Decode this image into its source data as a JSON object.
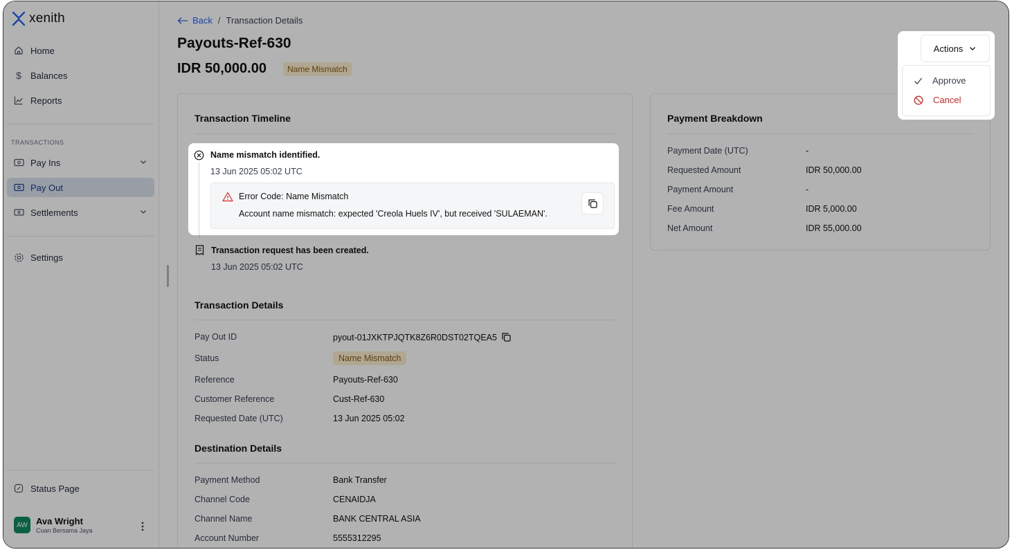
{
  "app": {
    "name": "xenith"
  },
  "sidebar": {
    "home": "Home",
    "balances": "Balances",
    "reports": "Reports",
    "section_label": "TRANSACTIONS",
    "pay_ins": "Pay Ins",
    "pay_out": "Pay Out",
    "settlements": "Settlements",
    "settings": "Settings",
    "status_page": "Status Page",
    "user": {
      "initials": "AW",
      "name": "Ava Wright",
      "org": "Cuan Bersama Jaya"
    }
  },
  "breadcrumb": {
    "back": "Back",
    "separator": "/",
    "current": "Transaction Details"
  },
  "header": {
    "title": "Payouts-Ref-630",
    "amount": "IDR 50,000.00",
    "status_badge": "Name Mismatch"
  },
  "actions": {
    "label": "Actions",
    "items": {
      "approve": "Approve",
      "cancel": "Cancel"
    }
  },
  "timeline": {
    "title": "Transaction Timeline",
    "items": [
      {
        "heading": "Name mismatch identified.",
        "time": "13 Jun 2025 05:02 UTC",
        "error_code": "Error Code: Name Mismatch",
        "error_message": "Account name mismatch: expected 'Creola Huels IV', but received 'SULAEMAN'."
      },
      {
        "heading": "Transaction request has been created.",
        "time": "13 Jun 2025 05:02 UTC"
      }
    ]
  },
  "details": {
    "title": "Transaction Details",
    "rows": [
      {
        "label": "Pay Out ID",
        "value": "pyout-01JXKTPJQTK8Z6R0DST02TQEA5"
      },
      {
        "label": "Status",
        "value": "Name Mismatch"
      },
      {
        "label": "Reference",
        "value": "Payouts-Ref-630"
      },
      {
        "label": "Customer Reference",
        "value": "Cust-Ref-630"
      },
      {
        "label": "Requested Date (UTC)",
        "value": "13 Jun 2025 05:02"
      }
    ]
  },
  "destination": {
    "title": "Destination Details",
    "rows": [
      {
        "label": "Payment Method",
        "value": "Bank Transfer"
      },
      {
        "label": "Channel Code",
        "value": "CENAIDJA"
      },
      {
        "label": "Channel Name",
        "value": "BANK CENTRAL ASIA"
      },
      {
        "label": "Account Number",
        "value": "5555312295"
      }
    ]
  },
  "breakdown": {
    "title": "Payment Breakdown",
    "rows": [
      {
        "label": "Payment Date (UTC)",
        "value": "-"
      },
      {
        "label": "Requested Amount",
        "value": "IDR 50,000.00"
      },
      {
        "label": "Payment Amount",
        "value": "-"
      },
      {
        "label": "Fee Amount",
        "value": "IDR 5,000.00"
      },
      {
        "label": "Net Amount",
        "value": "IDR 55,000.00"
      }
    ]
  },
  "colors": {
    "accent": "#2563eb",
    "danger": "#dc2626",
    "badge_bg": "#fcefd3",
    "badge_text": "#8a5a12",
    "active_nav": "#dbe3ee",
    "avatar": "#0f8a5f"
  }
}
